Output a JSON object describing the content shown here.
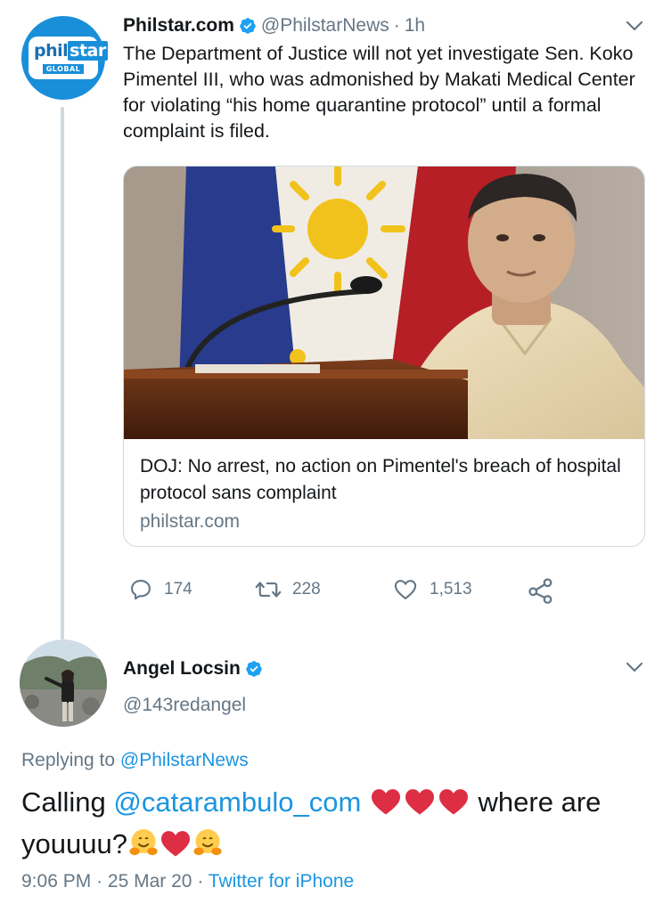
{
  "tweet1": {
    "author_name": "Philstar.com",
    "author_handle": "@PhilstarNews",
    "separator": "·",
    "time": "1h",
    "avatar_brand": "philstar",
    "avatar_brand_first": "phil",
    "avatar_brand_second": "star",
    "avatar_sub": "GLOBAL",
    "text": "The Department of Justice will not yet investigate Sen. Koko Pimentel III, who was admonished by Makati Medical Center for violating “his home quarantine protocol” until a formal complaint is filed.",
    "card": {
      "title": "DOJ: No arrest, no action on Pimentel's breach of hospital protocol sans complaint",
      "domain": "philstar.com"
    },
    "actions": {
      "replies": "174",
      "retweets": "228",
      "likes": "1,513"
    }
  },
  "tweet2": {
    "author_name": "Angel Locsin",
    "author_handle": "@143redangel",
    "replying_prefix": "Replying to",
    "replying_to": "@PhilstarNews",
    "text_before": "Calling",
    "mention": "@catarambulo_com",
    "text_after": "where are youuuu?",
    "meta_time": "9:06 PM",
    "meta_sep1": "·",
    "meta_date": "25 Mar 20",
    "meta_sep2": "·",
    "meta_source": "Twitter for iPhone"
  },
  "icons": {
    "verified": "verified-badge-icon",
    "chevron": "chevron-down-icon",
    "reply": "reply-icon",
    "retweet": "retweet-icon",
    "like": "heart-icon",
    "share": "share-icon",
    "heart_emoji": "red-heart-emoji",
    "hug_emoji": "hugging-face-emoji"
  },
  "colors": {
    "link": "#1b95e0",
    "secondary_text": "#657786",
    "verified": "#1da1f2",
    "philstar_blue": "#1a8fd9",
    "heart_red": "#dd2e44"
  }
}
